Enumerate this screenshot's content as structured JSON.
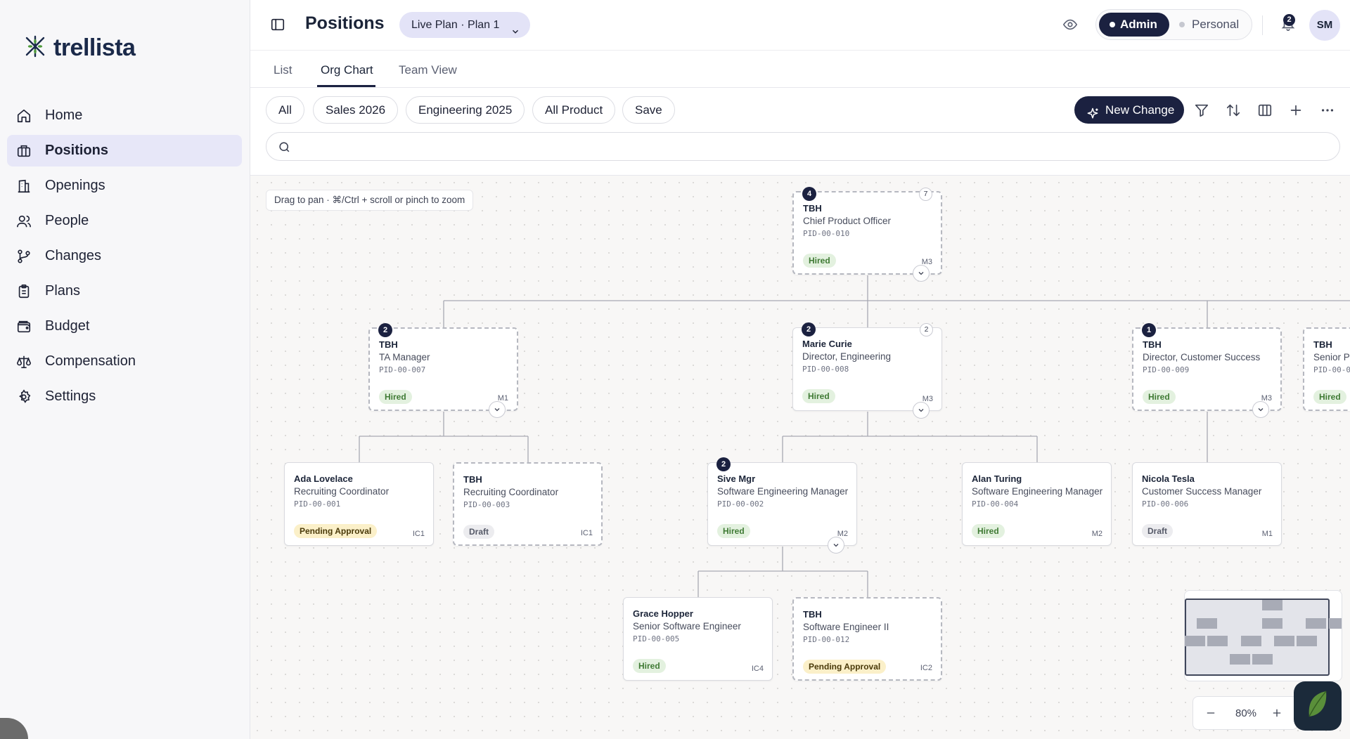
{
  "app": {
    "name": "trellista"
  },
  "sidebar": {
    "items": [
      {
        "label": "Home",
        "icon": "home-icon"
      },
      {
        "label": "Positions",
        "icon": "briefcase-icon",
        "active": true
      },
      {
        "label": "Openings",
        "icon": "building-icon"
      },
      {
        "label": "People",
        "icon": "people-icon"
      },
      {
        "label": "Changes",
        "icon": "git-branch-icon"
      },
      {
        "label": "Plans",
        "icon": "clipboard-icon"
      },
      {
        "label": "Budget",
        "icon": "wallet-icon"
      },
      {
        "label": "Compensation",
        "icon": "scale-icon"
      },
      {
        "label": "Settings",
        "icon": "gear-icon"
      }
    ]
  },
  "header": {
    "title": "Positions",
    "plan_selector": "Live Plan · Plan 1",
    "mode_admin": "Admin",
    "mode_personal": "Personal",
    "notification_count": "2",
    "avatar_initials": "SM"
  },
  "tabs": [
    "List",
    "Org Chart",
    "Team View"
  ],
  "active_tab": "Org Chart",
  "toolbar": {
    "chips": [
      "All",
      "Sales 2026",
      "Engineering 2025",
      "All Product",
      "Save"
    ],
    "new_change_label": "New Change",
    "search_placeholder": ""
  },
  "canvas": {
    "hint": "Drag to pan · ⌘/Ctrl + scroll or pinch to zoom",
    "zoom_level": "80%"
  },
  "cards": [
    {
      "id": "cpo",
      "name": "TBH",
      "title": "Chief Product Officer",
      "pid": "PID-00-010",
      "status": "Hired",
      "level": "M3",
      "badge": "4",
      "count": "7",
      "dashed": true,
      "expand": true
    },
    {
      "id": "ta",
      "name": "TBH",
      "title": "TA Manager",
      "pid": "PID-00-007",
      "status": "Hired",
      "level": "M1",
      "badge": "2",
      "count": "",
      "dashed": true,
      "expand": true
    },
    {
      "id": "deng",
      "name": "Marie Curie",
      "title": "Director, Engineering",
      "pid": "PID-00-008",
      "status": "Hired",
      "level": "M3",
      "badge": "2",
      "count": "2",
      "dashed": false,
      "expand": true
    },
    {
      "id": "dcs",
      "name": "TBH",
      "title": "Director, Customer Success",
      "pid": "PID-00-009",
      "status": "Hired",
      "level": "M3",
      "badge": "1",
      "count": "",
      "dashed": true,
      "expand": true
    },
    {
      "id": "spr",
      "name": "TBH",
      "title": "Senior Pr",
      "pid": "PID-00-0",
      "status": "Hired",
      "level": "",
      "badge": "",
      "count": "",
      "dashed": true,
      "expand": false
    },
    {
      "id": "rc1",
      "name": "Ada Lovelace",
      "title": "Recruiting Coordinator",
      "pid": "PID-00-001",
      "status": "Pending Approval",
      "level": "IC1",
      "badge": "",
      "count": "",
      "dashed": false,
      "expand": false
    },
    {
      "id": "rc2",
      "name": "TBH",
      "title": "Recruiting Coordinator",
      "pid": "PID-00-003",
      "status": "Draft",
      "level": "IC1",
      "badge": "",
      "count": "",
      "dashed": true,
      "expand": false
    },
    {
      "id": "sem1",
      "name": "Sive Mgr",
      "title": "Software Engineering Manager",
      "pid": "PID-00-002",
      "status": "Hired",
      "level": "M2",
      "badge": "2",
      "count": "",
      "dashed": false,
      "expand": true
    },
    {
      "id": "sem2",
      "name": "Alan Turing",
      "title": "Software Engineering Manager",
      "pid": "PID-00-004",
      "status": "Hired",
      "level": "M2",
      "badge": "",
      "count": "",
      "dashed": false,
      "expand": false
    },
    {
      "id": "csm",
      "name": "Nicola Tesla",
      "title": "Customer Success Manager",
      "pid": "PID-00-006",
      "status": "Draft",
      "level": "M1",
      "badge": "",
      "count": "",
      "dashed": false,
      "expand": false
    },
    {
      "id": "sse",
      "name": "Grace Hopper",
      "title": "Senior Software Engineer",
      "pid": "PID-00-005",
      "status": "Hired",
      "level": "IC4",
      "badge": "",
      "count": "",
      "dashed": false,
      "expand": false
    },
    {
      "id": "se2",
      "name": "TBH",
      "title": "Software Engineer II",
      "pid": "PID-00-012",
      "status": "Pending Approval",
      "level": "IC2",
      "badge": "",
      "count": "",
      "dashed": true,
      "expand": false
    }
  ],
  "colors": {
    "navy": "#1b2140",
    "active_nav_bg": "#e7e7f8",
    "hired_bg": "#e3f1df",
    "pending_bg": "#fbf0c9",
    "draft_bg": "#ececef"
  }
}
